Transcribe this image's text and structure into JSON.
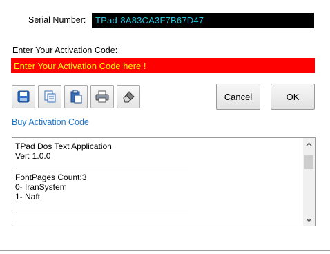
{
  "serial": {
    "label": "Serial Number:",
    "value": "TPad-8A83CA3F7B67D47"
  },
  "activation": {
    "label": "Enter Your Activation Code:",
    "placeholder": "Enter Your Activation Code here !"
  },
  "toolbar": {
    "icons": [
      "save-icon",
      "copy-icon",
      "paste-icon",
      "print-icon",
      "erase-icon"
    ]
  },
  "buttons": {
    "cancel": "Cancel",
    "ok": "OK"
  },
  "buy_link": "Buy Activation Code",
  "info": {
    "title": "TPad Dos Text Application",
    "version": "Ver: 1.0.0",
    "fontpages_count": "FontPages Count:3",
    "fonts": [
      "0- IranSystem",
      "1- Naft"
    ]
  },
  "colors": {
    "serial_bg": "#000000",
    "serial_text": "#20c8d8",
    "activation_bg": "#ff0000",
    "activation_text": "#ffff00",
    "link": "#1a75c9"
  }
}
